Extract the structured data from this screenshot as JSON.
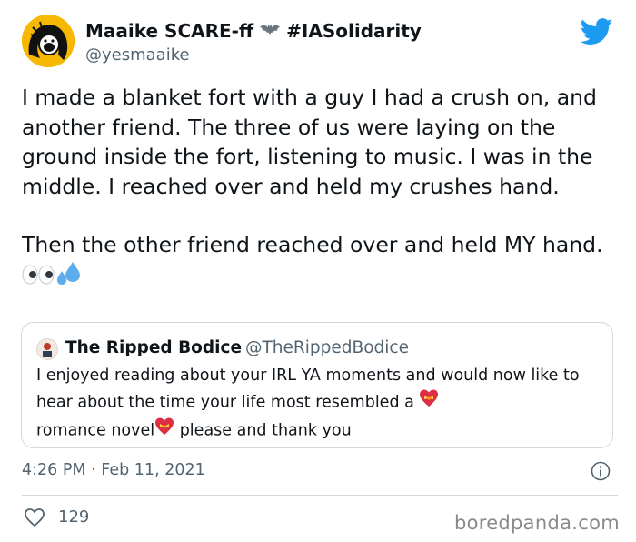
{
  "tweet": {
    "author_name": "Maaike SCARE-ff",
    "hashtag": "#IASolidarity",
    "handle": "@yesmaaike",
    "paragraphs": [
      "I made a blanket fort with a guy I had a crush on, and another friend. The three of us were laying on the ground inside the fort, listening to music. I was in the middle. I reached over and held my crushes hand.",
      "Then the other friend reached over and held MY hand."
    ],
    "quote": {
      "author_name": "The Ripped Bodice",
      "handle": "@TheRippedBodice",
      "text_part1": "I enjoyed reading about your IRL YA  moments and would now like to hear about the time your life most resembled a",
      "text_part2": "romance novel",
      "text_part3": "please and thank you"
    },
    "time": "4:26 PM",
    "separator": "·",
    "date": "Feb 11, 2021",
    "like_count": "129"
  },
  "watermark": "boredpanda.com",
  "icons": {
    "twitter": "twitter-bird-icon",
    "bat": "bat-icon",
    "eyes": "eyes-emoji",
    "sweat": "sweat-droplets-emoji",
    "heart_ribbon": "heart-with-ribbon-emoji",
    "info": "info-icon",
    "like": "heart-outline-icon"
  },
  "colors": {
    "twitter_blue": "#1d9bf0",
    "avatar_yellow": "#f6b800",
    "secondary_text": "#536471",
    "border": "#cfd9de"
  }
}
